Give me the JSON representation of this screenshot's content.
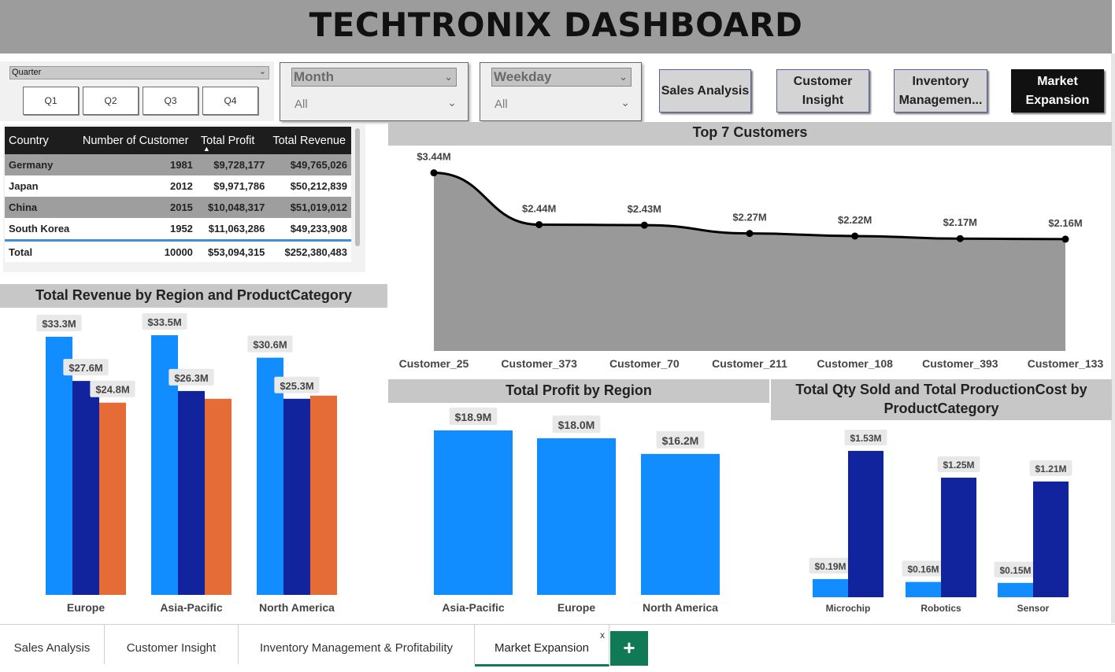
{
  "header": {
    "title": "TECHTRONIX DASHBOARD"
  },
  "slicers": {
    "quarter": {
      "label": "Quarter",
      "options": [
        "Q1",
        "Q2",
        "Q3",
        "Q4"
      ]
    },
    "month": {
      "label": "Month",
      "value": "All"
    },
    "weekday": {
      "label": "Weekday",
      "value": "All"
    }
  },
  "nav": {
    "sales_analysis": "Sales Analysis",
    "customer_insight": "Customer Insight",
    "inventory": "Inventory Managemen...",
    "market_expansion": "Market Expansion"
  },
  "table": {
    "columns": [
      "Country",
      "Number of Customer",
      "Total Profit",
      "Total Revenue"
    ],
    "rows": [
      [
        "Germany",
        "1981",
        "$9,728,177",
        "$49,765,026"
      ],
      [
        "Japan",
        "2012",
        "$9,971,786",
        "$50,212,839"
      ],
      [
        "China",
        "2015",
        "$10,048,317",
        "$51,019,012"
      ],
      [
        "South Korea",
        "1952",
        "$11,063,286",
        "$49,233,908"
      ]
    ],
    "total": [
      "Total",
      "10000",
      "$53,094,315",
      "$252,380,483"
    ]
  },
  "chart_data": [
    {
      "type": "area",
      "title": "Top 7 Customers",
      "categories": [
        "Customer_25",
        "Customer_373",
        "Customer_70",
        "Customer_211",
        "Customer_108",
        "Customer_393",
        "Customer_133"
      ],
      "values": [
        3.44,
        2.44,
        2.43,
        2.27,
        2.22,
        2.17,
        2.16
      ],
      "labels": [
        "$3.44M",
        "$2.44M",
        "$2.43M",
        "$2.27M",
        "$2.22M",
        "$2.17M",
        "$2.16M"
      ],
      "colors": {
        "fill": "#999999",
        "line": "#000000"
      }
    },
    {
      "type": "bar",
      "title": "Total Revenue by Region and ProductCategory",
      "categories": [
        "Europe",
        "Asia-Pacific",
        "North America"
      ],
      "series": [
        {
          "values": [
            33.3,
            33.5,
            30.6
          ],
          "labels": [
            "$33.3M",
            "$33.5M",
            "$30.6M"
          ],
          "color": "#118dff"
        },
        {
          "values": [
            27.6,
            26.3,
            25.3
          ],
          "labels": [
            "$27.6M",
            "$26.3M",
            "$25.3M"
          ],
          "color": "#12239e"
        },
        {
          "values": [
            24.8,
            25.3,
            25.7
          ],
          "labels": [
            "$24.8M",
            "",
            ""
          ],
          "color": "#e66c37"
        }
      ]
    },
    {
      "type": "bar",
      "title": "Total Profit by Region",
      "categories": [
        "Asia-Pacific",
        "Europe",
        "North America"
      ],
      "values": [
        18.9,
        18.0,
        16.2
      ],
      "labels": [
        "$18.9M",
        "$18.0M",
        "$16.2M"
      ],
      "color": "#118dff"
    },
    {
      "type": "bar",
      "title": "Total Qty Sold and Total ProductionCost by ProductCategory",
      "categories": [
        "Microchip",
        "Robotics",
        "Sensor"
      ],
      "series": [
        {
          "values": [
            0.19,
            0.16,
            0.15
          ],
          "labels": [
            "$0.19M",
            "$0.16M",
            "$0.15M"
          ],
          "color": "#118dff"
        },
        {
          "values": [
            1.53,
            1.25,
            1.21
          ],
          "labels": [
            "$1.53M",
            "$1.25M",
            "$1.21M"
          ],
          "color": "#12239e"
        }
      ]
    }
  ],
  "tabs": [
    {
      "label": "Sales Analysis"
    },
    {
      "label": "Customer Insight"
    },
    {
      "label": "Inventory Management & Profitability"
    },
    {
      "label": "Market Expansion"
    }
  ],
  "tab_close": "x",
  "add_tab": "+"
}
